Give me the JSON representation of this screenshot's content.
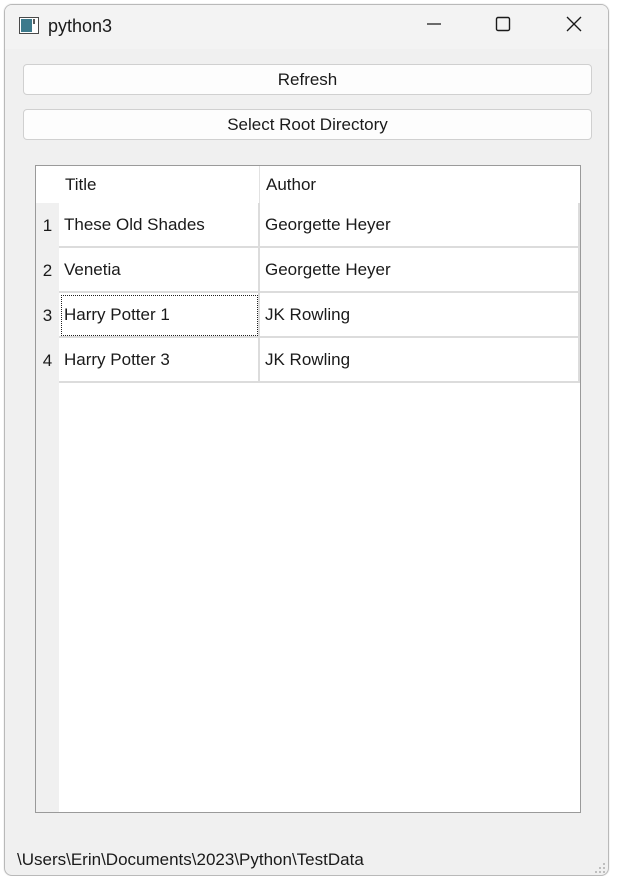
{
  "window": {
    "title": "python3"
  },
  "buttons": {
    "refresh": "Refresh",
    "select_root": "Select Root Directory"
  },
  "table": {
    "columns": [
      "Title",
      "Author"
    ],
    "rows": [
      {
        "num": "1",
        "title": "These Old Shades",
        "author": "Georgette Heyer"
      },
      {
        "num": "2",
        "title": "Venetia",
        "author": "Georgette Heyer"
      },
      {
        "num": "3",
        "title": "Harry Potter 1",
        "author": "JK Rowling"
      },
      {
        "num": "4",
        "title": "Harry Potter 3",
        "author": "JK Rowling"
      }
    ],
    "focused_row": 3
  },
  "status": {
    "path": "\\Users\\Erin\\Documents\\2023\\Python\\TestData"
  },
  "icons": {
    "app": "app-window-icon",
    "minimize": "minimize-icon",
    "maximize": "maximize-icon",
    "close": "close-icon",
    "grip": "resize-grip-icon"
  }
}
